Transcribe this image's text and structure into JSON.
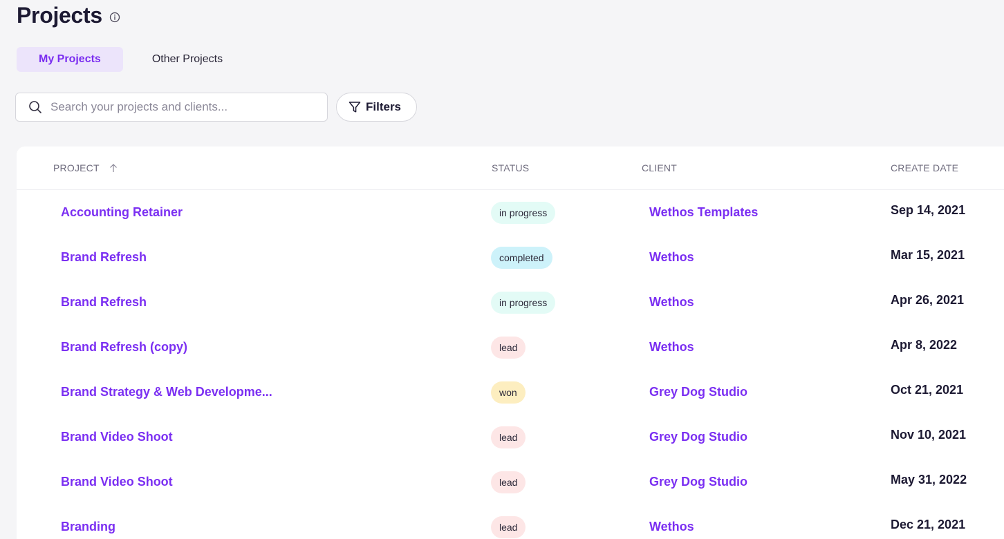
{
  "header": {
    "title": "Projects"
  },
  "tabs": [
    {
      "label": "My Projects",
      "active": true
    },
    {
      "label": "Other Projects",
      "active": false
    }
  ],
  "search": {
    "placeholder": "Search your projects and clients...",
    "value": ""
  },
  "filters": {
    "label": "Filters"
  },
  "table": {
    "headers": {
      "project": "PROJECT",
      "status": "STATUS",
      "client": "CLIENT",
      "create_date": "CREATE DATE"
    },
    "rows": [
      {
        "project": "Accounting Retainer",
        "status": "in progress",
        "client": "Wethos Templates",
        "date": "Sep 14, 2021"
      },
      {
        "project": "Brand Refresh",
        "status": "completed",
        "client": "Wethos",
        "date": "Mar 15, 2021"
      },
      {
        "project": "Brand Refresh",
        "status": "in progress",
        "client": "Wethos",
        "date": "Apr 26, 2021"
      },
      {
        "project": "Brand Refresh (copy)",
        "status": "lead",
        "client": "Wethos",
        "date": "Apr 8, 2022"
      },
      {
        "project": "Brand Strategy & Web Developme...",
        "status": "won",
        "client": "Grey Dog Studio",
        "date": "Oct 21, 2021"
      },
      {
        "project": "Brand Video Shoot",
        "status": "lead",
        "client": "Grey Dog Studio",
        "date": "Nov 10, 2021"
      },
      {
        "project": "Brand Video Shoot",
        "status": "lead",
        "client": "Grey Dog Studio",
        "date": "May 31, 2022"
      },
      {
        "project": "Branding",
        "status": "lead",
        "client": "Wethos",
        "date": "Dec 21, 2021"
      }
    ]
  },
  "colors": {
    "accent": "#7b2ff2",
    "status_in_progress": "#e3fbf6",
    "status_completed": "#cdf2fa",
    "status_lead": "#fde6e6",
    "status_won": "#fdeec0"
  },
  "icons": {
    "info": "info-icon",
    "search": "search-icon",
    "filter": "filter-icon",
    "sort": "arrow-up-icon"
  }
}
